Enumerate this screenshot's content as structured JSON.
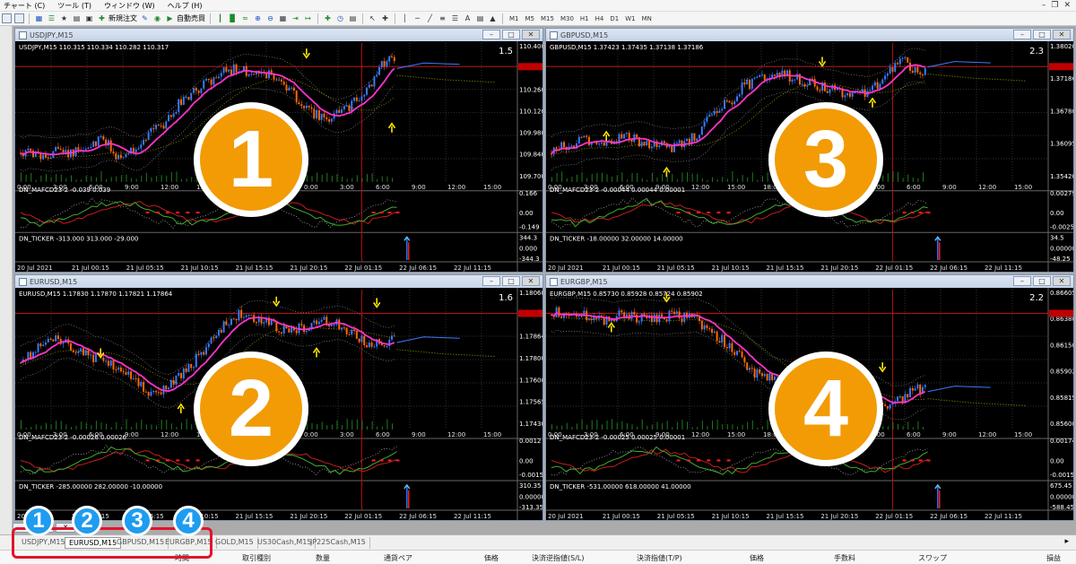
{
  "menu": {
    "items": [
      "チャート (C)",
      "ツール (T)",
      "ウィンドウ (W)",
      "ヘルプ (H)"
    ]
  },
  "toolbar": {
    "new_order": "新規注文",
    "auto_trade": "自動売買",
    "text_tool": "A",
    "timeframes": [
      "M1",
      "M5",
      "M15",
      "M30",
      "H1",
      "H4",
      "D1",
      "W1",
      "MN"
    ]
  },
  "charts": [
    {
      "title": "USDJPY,M15",
      "header": "USDJPY,M15  110.315 110.334 110.282 110.317",
      "spread": "1.5",
      "price_labels": [
        "110.400",
        "110.317",
        "110.260",
        "110.120",
        "109.980",
        "109.840",
        "109.700"
      ],
      "time_labels": [
        "0:00",
        "3:00",
        "6:00",
        "9:00",
        "12:00",
        "15:00",
        "18:00",
        "21:00",
        "0:00",
        "3:00",
        "6:00",
        "9:00",
        "12:00",
        "15:00"
      ],
      "macd_header": "DN_MAFCD23-2 -0.039 0.039",
      "macd_labels": [
        "0.166",
        "0.00",
        "-0.149"
      ],
      "ticker_header": "DN_TICKER -313.000 313.000 -29.000",
      "ticker_labels": [
        "344.3",
        "0.000",
        "-344.3"
      ],
      "date_labels": [
        "20 Jul 2021",
        "21 Jul 00:15",
        "21 Jul 05:15",
        "21 Jul 10:15",
        "21 Jul 15:15",
        "21 Jul 20:15",
        "22 Jul 01:15",
        "22 Jul 06:15",
        "22 Jul 11:15"
      ],
      "badge": "1"
    },
    {
      "title": "GBPUSD,M15",
      "header": "GBPUSD,M15  1.37423 1.37435 1.37138 1.37186",
      "spread": "2.3",
      "price_labels": [
        "1.38020",
        "1.37186",
        "1.36780",
        "1.36095",
        "1.35420"
      ],
      "time_labels": [
        "0:00",
        "3:00",
        "6:00",
        "9:00",
        "12:00",
        "15:00",
        "18:00",
        "21:00",
        "0:00",
        "3:00",
        "6:00",
        "9:00",
        "12:00",
        "15:00"
      ],
      "macd_header": "DN_MAFCD23-2 -0.00044 0.00044 0.00001",
      "macd_labels": [
        "0.00279",
        "0.00",
        "-0.00250"
      ],
      "ticker_header": "DN_TICKER -18.00000 32.00000 14.00000",
      "ticker_labels": [
        "34.5",
        "0.00000",
        "-48.25"
      ],
      "date_labels": [
        "20 Jul 2021",
        "21 Jul 00:15",
        "21 Jul 05:15",
        "21 Jul 10:15",
        "21 Jul 15:15",
        "21 Jul 20:15",
        "22 Jul 01:15",
        "22 Jul 06:15",
        "22 Jul 11:15"
      ],
      "badge": "3"
    },
    {
      "title": "EURUSD,M15",
      "header": "EURUSD,M15  1.17830 1.17870 1.17821 1.17864",
      "spread": "1.6",
      "price_labels": [
        "1.18060",
        "1.17935",
        "1.17864",
        "1.17800",
        "1.17600",
        "1.17565",
        "1.17430"
      ],
      "time_labels": [
        "0:00",
        "3:00",
        "6:00",
        "9:00",
        "12:00",
        "15:00",
        "18:00",
        "21:00",
        "0:00",
        "3:00",
        "6:00",
        "9:00",
        "12:00",
        "15:00"
      ],
      "macd_header": "DN_MAFCD23-2 -0.00026 0.00026",
      "macd_labels": [
        "0.0012",
        "0.00",
        "-0.0015"
      ],
      "ticker_header": "DN_TICKER -285.00000 282.00000 -10.00000",
      "ticker_labels": [
        "310.35",
        "0.00000",
        "-313.35"
      ],
      "date_labels": [
        "20 Jul 2021",
        "21 Jul 00:15",
        "21 Jul 05:15",
        "21 Jul 10:15",
        "21 Jul 15:15",
        "21 Jul 20:15",
        "22 Jul 01:15",
        "22 Jul 06:15",
        "22 Jul 11:15"
      ],
      "badge": "2"
    },
    {
      "title": "EURGBP,M15",
      "header": "EURGBP,M15  0.85730 0.85928 0.85724 0.85902",
      "spread": "2.2",
      "price_labels": [
        "0.86605",
        "0.86380",
        "0.86150",
        "0.85902",
        "0.85815",
        "0.85600"
      ],
      "time_labels": [
        "0:00",
        "3:00",
        "6:00",
        "9:00",
        "12:00",
        "15:00",
        "18:00",
        "21:00",
        "0:00",
        "3:00",
        "6:00",
        "9:00",
        "12:00",
        "15:00"
      ],
      "macd_header": "DN_MAFCD23-2 -0.00025 0.00025 0.00001",
      "macd_labels": [
        "0.00174",
        "0.00",
        "-0.00150"
      ],
      "ticker_header": "DN_TICKER -531.00000 618.00000 41.00000",
      "ticker_labels": [
        "675.45",
        "0.00000",
        "-588.45"
      ],
      "date_labels": [
        "20 Jul 2021",
        "21 Jul 00:15",
        "21 Jul 05:15",
        "21 Jul 10:15",
        "21 Jul 15:15",
        "21 Jul 20:15",
        "22 Jul 01:15",
        "22 Jul 06:15",
        "22 Jul 11:15"
      ],
      "badge": "4"
    }
  ],
  "chart_tabs": [
    "USDJPY,M15",
    "EURUSD,M15",
    "GBPUSD,M15",
    "EURGBP,M15",
    "GOLD,M15",
    "US30Cash,M15",
    "JP225Cash,M15"
  ],
  "active_tab_index": 1,
  "mini_badges": [
    "1",
    "2",
    "3",
    "4"
  ],
  "terminal_columns": [
    "時間",
    "取引種別",
    "数量",
    "通貨ペア",
    "価格",
    "決済逆指値(S/L)",
    "決済指値(T/P)",
    "価格",
    "手数料",
    "スワップ",
    "損益"
  ],
  "colors": {
    "badge_orange": "#f29b05",
    "badge_blue": "#1e9cf0",
    "highlight_red": "#e3142a",
    "bull_candle": "#3a7bff",
    "bear_candle": "#ff6a00",
    "ma_line": "#ff33cc"
  }
}
